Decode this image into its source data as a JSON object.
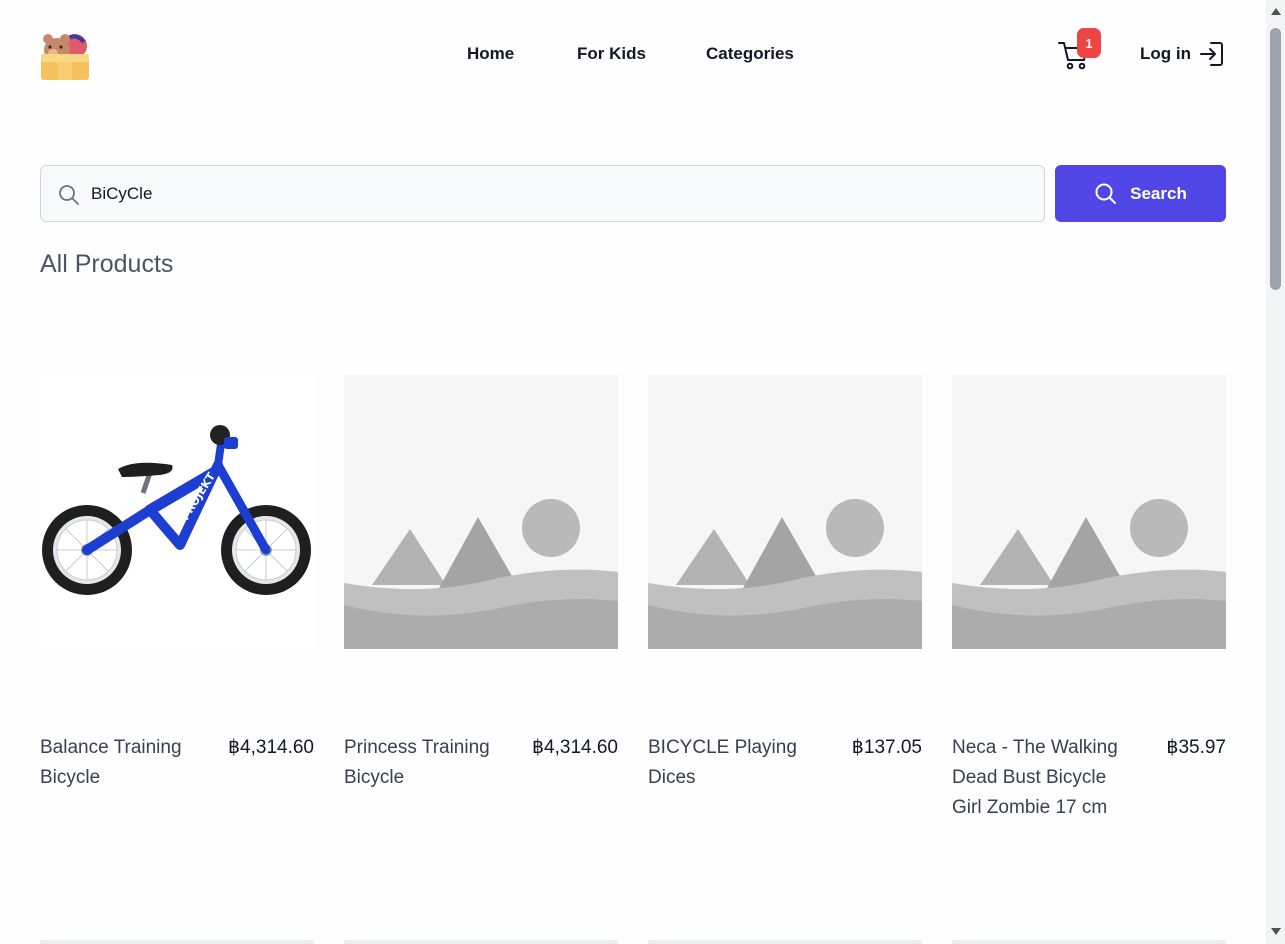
{
  "nav": {
    "items": [
      {
        "label": "Home"
      },
      {
        "label": "For Kids"
      },
      {
        "label": "Categories"
      }
    ],
    "cart_count": "1",
    "login_label": "Log in"
  },
  "search": {
    "value": "BiCyCle",
    "button_label": "Search"
  },
  "section_title": "All Products",
  "products": [
    {
      "name": "Balance Training Bicycle",
      "price": "฿4,314.60",
      "image": "blue-balance-bike"
    },
    {
      "name": "Princess Training Bicycle",
      "price": "฿4,314.60",
      "image": "placeholder"
    },
    {
      "name": "BICYCLE Playing Dices",
      "price": "฿137.05",
      "image": "placeholder"
    },
    {
      "name": "Neca - The Walking Dead Bust Bicycle Girl Zombie 17 cm",
      "price": "฿35.97",
      "image": "placeholder"
    }
  ],
  "colors": {
    "primary": "#4f46e5",
    "badge": "#ef4444",
    "text": "#111827",
    "muted": "#4b5563"
  }
}
